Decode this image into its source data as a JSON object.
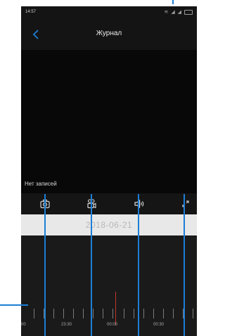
{
  "status_bar": {
    "time": "14:57",
    "icons": [
      "wifi-icon",
      "signal-icon",
      "signal-icon",
      "battery-icon"
    ]
  },
  "header": {
    "title": "Журнал",
    "back_icon": "chevron-left-icon"
  },
  "video": {
    "message": "Нет записей"
  },
  "controls": [
    {
      "name": "snapshot-button",
      "icon": "camera-icon"
    },
    {
      "name": "record-button",
      "icon": "video-camera-icon"
    },
    {
      "name": "sound-button",
      "icon": "speaker-icon"
    },
    {
      "name": "fullscreen-button",
      "icon": "expand-icon"
    }
  ],
  "date_bar": {
    "date": "2018-06-21"
  },
  "timeline": {
    "labels": [
      "00",
      "23:30",
      "00:00",
      "00:30"
    ]
  },
  "colors": {
    "accent": "#1b7fd6",
    "current_time_marker": "#c0392b",
    "background": "#1a1a1a"
  }
}
